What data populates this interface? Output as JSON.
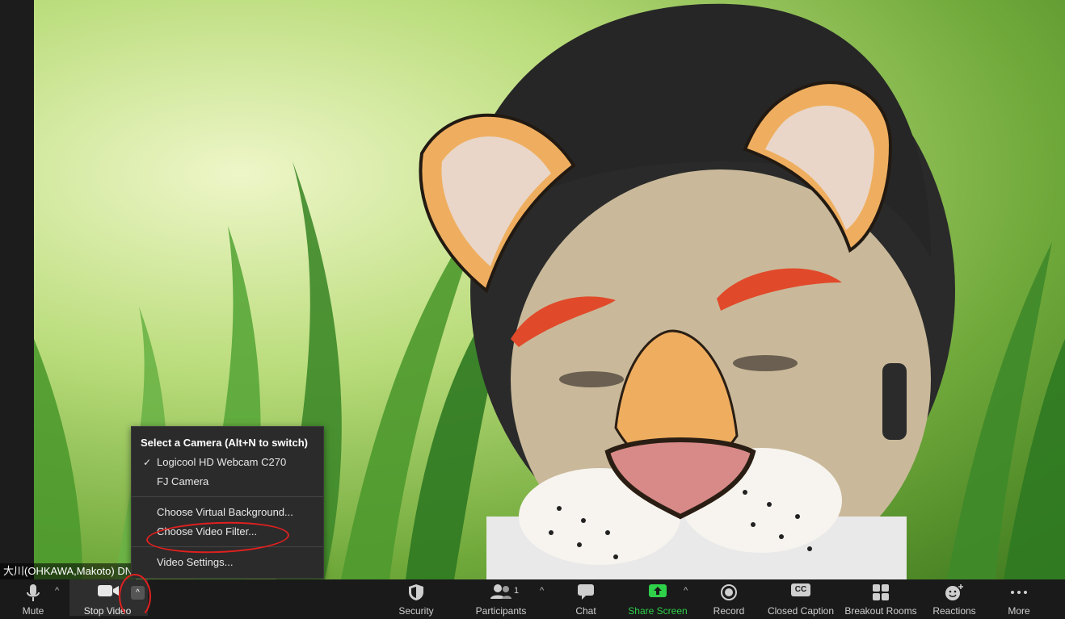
{
  "participant_name": "大川(OHKAWA,Makoto) DN",
  "camera_menu": {
    "header": "Select a Camera (Alt+N to switch)",
    "cameras": [
      {
        "label": "Logicool HD Webcam C270",
        "selected": true
      },
      {
        "label": "FJ Camera",
        "selected": false
      }
    ],
    "choose_virtual_background": "Choose Virtual Background...",
    "choose_video_filter": "Choose Video Filter...",
    "video_settings": "Video Settings...",
    "check_mark": "✓"
  },
  "toolbar": {
    "mute": "Mute",
    "stop_video": "Stop Video",
    "security": "Security",
    "participants": "Participants",
    "participants_count": "1",
    "chat": "Chat",
    "share_screen": "Share Screen",
    "record": "Record",
    "closed_caption": "Closed Caption",
    "closed_caption_icon_text": "CC",
    "breakout_rooms": "Breakout Rooms",
    "reactions": "Reactions",
    "more": "More"
  },
  "colors": {
    "share_green": "#2fd04a",
    "annotation_red": "#e02020",
    "toolbar_bg": "#1a1a1a"
  },
  "icons": [
    "microphone-icon",
    "video-camera-icon",
    "chevron-up-icon",
    "shield-icon",
    "participants-icon",
    "chat-bubble-icon",
    "share-screen-icon",
    "record-icon",
    "cc-icon",
    "breakout-rooms-icon",
    "reactions-icon",
    "more-dots-icon",
    "checkmark-icon"
  ]
}
